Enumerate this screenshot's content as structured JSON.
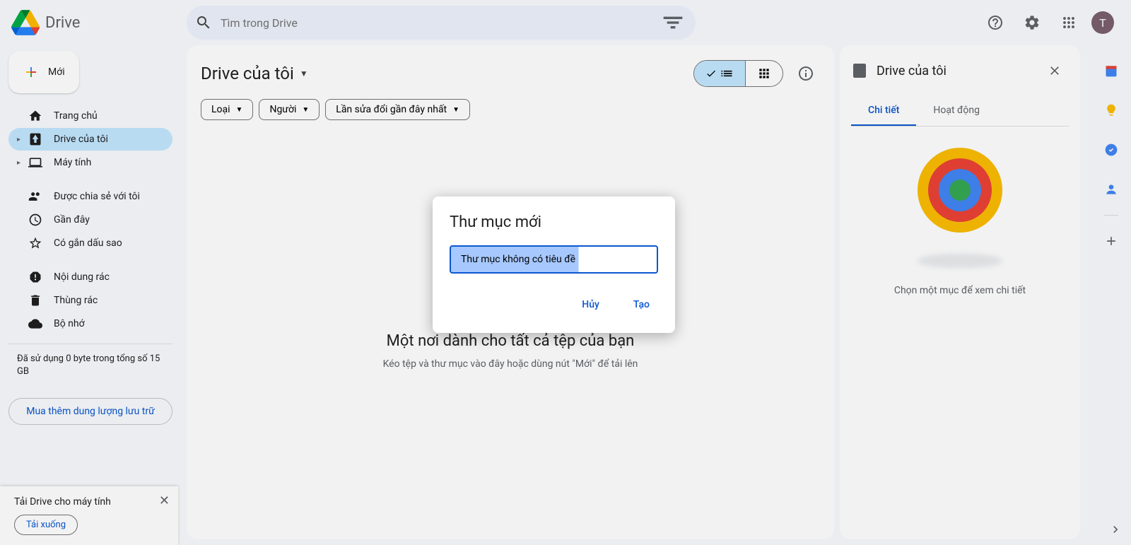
{
  "header": {
    "app_name": "Drive",
    "search_placeholder": "Tìm trong Drive"
  },
  "sidebar": {
    "new_button": "Mới",
    "items": [
      {
        "label": "Trang chủ",
        "icon": "home"
      },
      {
        "label": "Drive của tôi",
        "icon": "drive",
        "active": true,
        "expandable": true
      },
      {
        "label": "Máy tính",
        "icon": "computer",
        "expandable": true
      }
    ],
    "items2": [
      {
        "label": "Được chia sẻ với tôi",
        "icon": "shared"
      },
      {
        "label": "Gần đây",
        "icon": "recent"
      },
      {
        "label": "Có gắn dấu sao",
        "icon": "star"
      }
    ],
    "items3": [
      {
        "label": "Nội dung rác",
        "icon": "spam"
      },
      {
        "label": "Thùng rác",
        "icon": "trash"
      },
      {
        "label": "Bộ nhớ",
        "icon": "storage"
      }
    ],
    "storage_text": "Đã sử dụng 0 byte trong tổng số 15 GB",
    "storage_button": "Mua thêm dung lượng lưu trữ"
  },
  "main": {
    "title": "Drive của tôi",
    "filters": [
      {
        "label": "Loại"
      },
      {
        "label": "Người"
      },
      {
        "label": "Lần sửa đổi gần đây nhất"
      }
    ],
    "empty_title": "Một nơi dành cho tất cả tệp của bạn",
    "empty_subtitle": "Kéo tệp và thư mục vào đây hoặc dùng nút \"Mới\" để tải lên"
  },
  "detail": {
    "title": "Drive của tôi",
    "tabs": [
      {
        "label": "Chi tiết",
        "active": true
      },
      {
        "label": "Hoạt động"
      }
    ],
    "empty_text": "Chọn một mục để xem chi tiết"
  },
  "modal": {
    "title": "Thư mục mới",
    "input_value": "Thư mục không có tiêu đề",
    "cancel": "Hủy",
    "create": "Tạo"
  },
  "toast": {
    "title": "Tải Drive cho máy tính",
    "button": "Tải xuống"
  },
  "avatar_letter": "T"
}
